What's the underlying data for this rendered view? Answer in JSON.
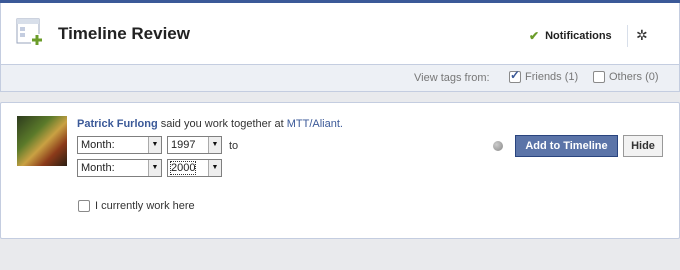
{
  "header": {
    "title": "Timeline Review",
    "notifications_label": "Notifications",
    "settings_icon": "gear-icon",
    "accent_color": "#3b5998"
  },
  "filter": {
    "label": "View tags from:",
    "options": [
      {
        "label": "Friends (1)",
        "checked": true
      },
      {
        "label": "Others (0)",
        "checked": false
      }
    ]
  },
  "story": {
    "actor": "Patrick Furlong",
    "text": "said you work together at",
    "place": "MTT/Aliant.",
    "start_month": "Month:",
    "start_year": "1997",
    "to_label": "to",
    "end_month": "Month:",
    "end_year": "2000",
    "current_label": "I currently work here",
    "add_button": "Add to Timeline",
    "hide_button": "Hide"
  }
}
